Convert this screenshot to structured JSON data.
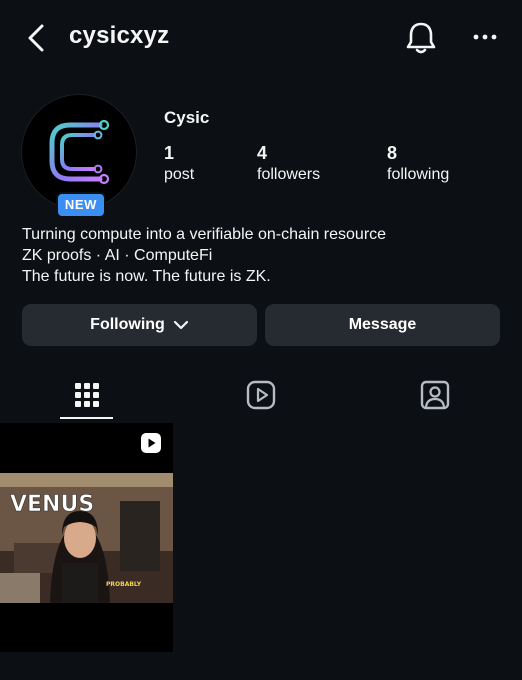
{
  "header": {
    "username": "cysicxyz"
  },
  "profile": {
    "display_name": "Cysic",
    "badge": "NEW",
    "stats": [
      {
        "value": "1",
        "label": "post"
      },
      {
        "value": "4",
        "label": "followers"
      },
      {
        "value": "8",
        "label": "following"
      }
    ],
    "bio": [
      "Turning compute into a verifiable on-chain resource",
      "ZK proofs · AI · ComputeFi",
      "The future is now. The future is ZK."
    ]
  },
  "actions": {
    "following_label": "Following",
    "message_label": "Message"
  },
  "tabs": [
    {
      "icon": "grid-icon",
      "active": true
    },
    {
      "icon": "reels-icon",
      "active": false
    },
    {
      "icon": "tagged-icon",
      "active": false
    }
  ],
  "posts": [
    {
      "type": "reel",
      "overlay_title": "VENUS",
      "overlay_caption": "PROBABLY"
    }
  ],
  "colors": {
    "background": "#0c0f14",
    "button": "#262a31",
    "badge": "#3b8ef2",
    "logo_gradient": [
      "#4fd1c5",
      "#8a7cf5",
      "#c77dff"
    ]
  }
}
